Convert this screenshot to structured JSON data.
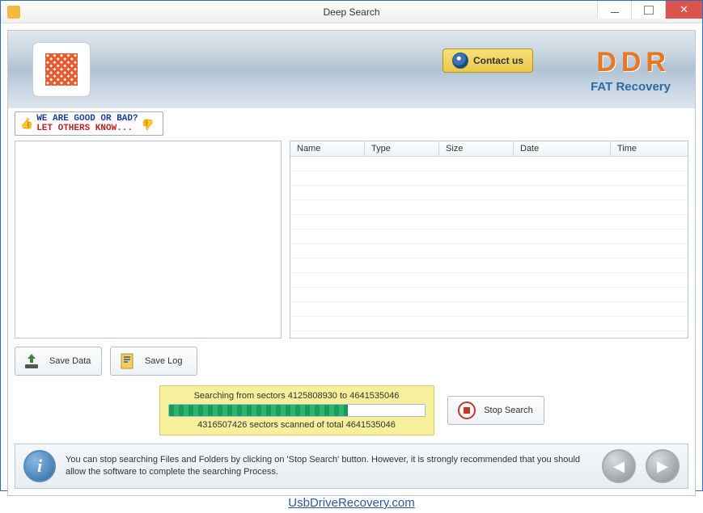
{
  "window": {
    "title": "Deep Search"
  },
  "banner": {
    "contact_label": "Contact us",
    "brand_top": "DDR",
    "brand_sub": "FAT Recovery"
  },
  "rating": {
    "line1": "WE ARE GOOD OR BAD?",
    "line2": "LET OTHERS KNOW..."
  },
  "columns": {
    "name": "Name",
    "type": "Type",
    "size": "Size",
    "date": "Date",
    "time": "Time"
  },
  "buttons": {
    "save_data": "Save Data",
    "save_log": "Save Log",
    "stop_search": "Stop Search"
  },
  "progress": {
    "line1": "Searching from sectors  4125808930 to 4641535046",
    "line2": "4316507426 sectors scanned of total 4641535046",
    "sector_from": 4125808930,
    "sector_to": 4641535046,
    "sectors_scanned": 4316507426
  },
  "info": {
    "text": "You can stop searching Files and Folders by clicking on 'Stop Search' button. However, it is strongly recommended that you should allow the software to complete the searching Process."
  },
  "footer": {
    "link": "UsbDriveRecovery.com"
  }
}
